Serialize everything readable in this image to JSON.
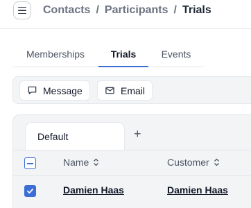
{
  "header": {
    "breadcrumb": [
      "Contacts",
      "Participants",
      "Trials"
    ],
    "separator": "/"
  },
  "tabs": [
    {
      "label": "Memberships",
      "active": false
    },
    {
      "label": "Trials",
      "active": true
    },
    {
      "label": "Events",
      "active": false
    }
  ],
  "toolbar": {
    "message_label": "Message",
    "email_label": "Email"
  },
  "table": {
    "view_tab_label": "Default",
    "add_view_symbol": "+",
    "columns": [
      "Name",
      "Customer"
    ],
    "rows": [
      {
        "selected": true,
        "name": "Damien Haas",
        "customer": "Damien Haas"
      }
    ]
  },
  "colors": {
    "accent": "#3b6fd6",
    "panel_bg": "#f3f4f6",
    "border": "#e5e7eb"
  }
}
